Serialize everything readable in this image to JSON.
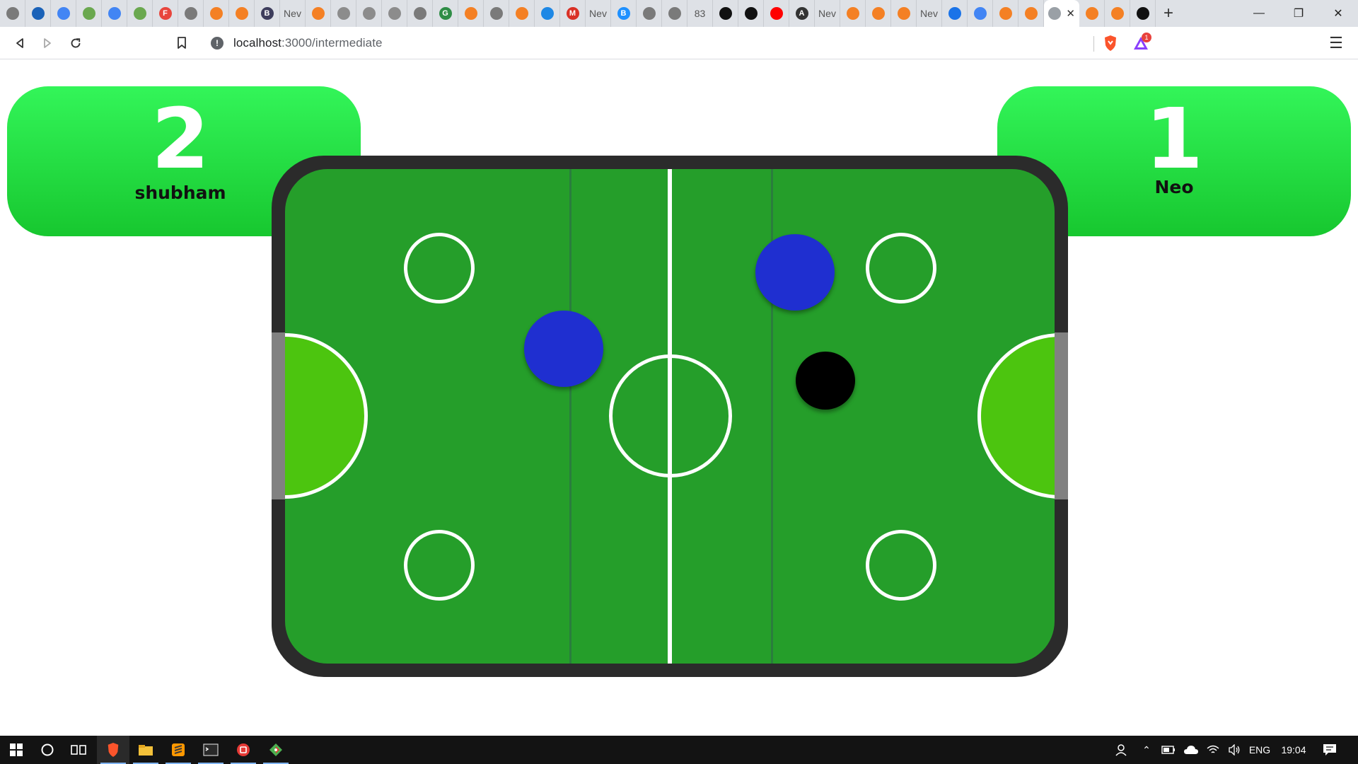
{
  "browser": {
    "tabs": [
      {
        "icon": "globe-icon",
        "color": "#7a7a7a"
      },
      {
        "icon": "edge-icon",
        "color": "#1a62b8"
      },
      {
        "icon": "google-icon",
        "color": "#4285f4"
      },
      {
        "icon": "spreadsheet-icon",
        "color": "#6aa84f"
      },
      {
        "icon": "google-icon",
        "color": "#4285f4"
      },
      {
        "icon": "spreadsheet-icon",
        "color": "#6aa84f"
      },
      {
        "icon": "f-icon",
        "color": "#e8453c",
        "text": "F"
      },
      {
        "icon": "globe-icon",
        "color": "#7a7a7a"
      },
      {
        "icon": "stack-icon",
        "color": "#f48024"
      },
      {
        "icon": "stack-icon",
        "color": "#f48024"
      },
      {
        "icon": "b-icon",
        "color": "#3d3d5c",
        "text": "B"
      },
      {
        "icon": "new-tab-icon",
        "color": "#555555",
        "text": "Nev"
      },
      {
        "icon": "stack-icon",
        "color": "#f48024"
      },
      {
        "icon": "owl-icon",
        "color": "#8c8c8c"
      },
      {
        "icon": "owl-icon",
        "color": "#8c8c8c"
      },
      {
        "icon": "owl-icon",
        "color": "#8c8c8c"
      },
      {
        "icon": "globe-icon",
        "color": "#7a7a7a"
      },
      {
        "icon": "gfg-icon",
        "color": "#2f8d46",
        "text": "G"
      },
      {
        "icon": "stack-icon",
        "color": "#f48024"
      },
      {
        "icon": "globe-icon",
        "color": "#7a7a7a"
      },
      {
        "icon": "stack-icon",
        "color": "#f48024"
      },
      {
        "icon": "flag-icon",
        "color": "#1e88e5"
      },
      {
        "icon": "gmail-icon",
        "color": "#d93025",
        "text": "M"
      },
      {
        "icon": "new-tab-icon",
        "color": "#555555",
        "text": "Nev"
      },
      {
        "icon": "b-icon",
        "color": "#1e90ff",
        "text": "B"
      },
      {
        "icon": "globe-icon",
        "color": "#7a7a7a"
      },
      {
        "icon": "globe-icon",
        "color": "#7a7a7a"
      },
      {
        "icon": "number-icon",
        "color": "#555555",
        "text": "83"
      },
      {
        "icon": "github-icon",
        "color": "#111111"
      },
      {
        "icon": "github-icon",
        "color": "#111111"
      },
      {
        "icon": "youtube-icon",
        "color": "#ff0000"
      },
      {
        "icon": "a-icon",
        "color": "#333333",
        "text": "A"
      },
      {
        "icon": "new-tab-icon",
        "color": "#555555",
        "text": "Nev"
      },
      {
        "icon": "stack-icon",
        "color": "#f48024"
      },
      {
        "icon": "stack-icon",
        "color": "#f48024"
      },
      {
        "icon": "stack-icon",
        "color": "#f48024"
      },
      {
        "icon": "new-tab-icon",
        "color": "#555555",
        "text": "Nev"
      },
      {
        "icon": "triangle-icon",
        "color": "#1a73e8"
      },
      {
        "icon": "google-icon",
        "color": "#4285f4"
      },
      {
        "icon": "stack-icon",
        "color": "#f48024"
      },
      {
        "icon": "stack-icon",
        "color": "#f48024"
      }
    ],
    "trailing_tabs": [
      {
        "icon": "stack-icon",
        "color": "#f48024"
      },
      {
        "icon": "stack-icon",
        "color": "#f48024"
      },
      {
        "icon": "github-icon",
        "color": "#111111"
      }
    ],
    "url_host": "localhost",
    "url_path": ":3000/intermediate",
    "ext_badge": "1"
  },
  "game": {
    "player1": {
      "name": "shubham",
      "score": "2"
    },
    "player2": {
      "name": "Neo",
      "score": "1"
    },
    "colors": {
      "border": "#2b2b2b",
      "field": "#259e2a",
      "goal_area": "#4cc50f",
      "mallet": "#1f2fd0",
      "puck": "#000000",
      "score_panel": "#22dd44"
    }
  },
  "taskbar": {
    "apps": [
      "windows-start-icon",
      "search-icon",
      "task-view-icon",
      "brave-icon",
      "file-explorer-icon",
      "sublime-icon",
      "terminal-icon",
      "app-icon",
      "git-icon"
    ],
    "language": "ENG",
    "time": "19:04"
  }
}
